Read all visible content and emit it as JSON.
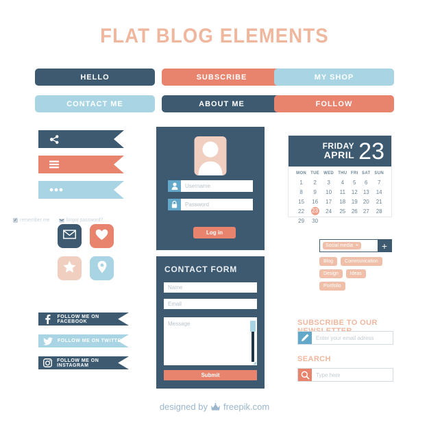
{
  "title": "FLAT BLOG ELEMENTS",
  "colors": {
    "dark": "#3d5a70",
    "salmon": "#e8836d",
    "light_blue": "#a8d4e3",
    "peach": "#f0cfc0",
    "title_peach": "#eeb79e",
    "tag_peach": "#f0bfa9",
    "white": "#ffffff"
  },
  "buttons": [
    {
      "label": "HELLO",
      "style": "b-dark"
    },
    {
      "label": "SUBSCRIBE",
      "style": "b-salmon"
    },
    {
      "label": "MY SHOP",
      "style": "b-lblue"
    },
    {
      "label": "CONTACT ME",
      "style": "b-lblue"
    },
    {
      "label": "ABOUT ME",
      "style": "b-dark"
    },
    {
      "label": "FOLLOW",
      "style": "b-salmon"
    }
  ],
  "ribbons": [
    {
      "icon": "share-icon",
      "style": "b-dark"
    },
    {
      "icon": "hamburger-icon",
      "style": "b-salmon"
    },
    {
      "icon": "ellipsis-icon",
      "style": "b-lblue"
    }
  ],
  "tiles": [
    {
      "icon": "envelope-icon",
      "bg": "#3d5a70",
      "fg": "#ffffff"
    },
    {
      "icon": "heart-icon",
      "bg": "#e8836d",
      "fg": "#ffffff"
    },
    {
      "icon": "star-icon",
      "bg": "#f0cfc0",
      "fg": "#ffffff"
    },
    {
      "icon": "location-pin-icon",
      "bg": "#a8d4e3",
      "fg": "#ffffff"
    }
  ],
  "social": [
    {
      "icon": "facebook-icon",
      "label": "FOLLOW ME ON FACEBOOK",
      "style": "b-dark"
    },
    {
      "icon": "twitter-icon",
      "label": "FOLLOW ME ON TWITTER",
      "style": "b-lblue"
    },
    {
      "icon": "instagram-icon",
      "label": "FOLLOW ME ON INSTAGRAM",
      "style": "b-dark"
    }
  ],
  "login": {
    "avatar_icon": "user-avatar-icon",
    "username": {
      "icon": "user-icon",
      "placeholder": "Username",
      "value": ""
    },
    "password": {
      "icon": "lock-icon",
      "placeholder": "Password",
      "value": ""
    },
    "remember_label": "remember me",
    "remember_checked": true,
    "forgot_label": "forgot password?",
    "forgot_icon": "envelope-icon",
    "submit_label": "Log in"
  },
  "contact_form": {
    "title": "CONTACT FORM",
    "name": {
      "placeholder": "Name",
      "value": ""
    },
    "email": {
      "placeholder": "Email",
      "value": ""
    },
    "message": {
      "placeholder": "Message",
      "value": ""
    },
    "submit_label": "Submit"
  },
  "calendar": {
    "weekday": "FRIDAY",
    "month": "APRIL",
    "day_number": "23",
    "day_headers": [
      "MON",
      "TUE",
      "WED",
      "THU",
      "FRI",
      "SAT",
      "SUN"
    ],
    "weeks": [
      [
        "1",
        "2",
        "3",
        "4",
        "5",
        "6",
        "7"
      ],
      [
        "8",
        "9",
        "10",
        "11",
        "12",
        "13",
        "14"
      ],
      [
        "15",
        "16",
        "17",
        "18",
        "19",
        "20",
        "21"
      ],
      [
        "22",
        "23",
        "24",
        "25",
        "26",
        "27",
        "28"
      ],
      [
        "29",
        "30",
        "",
        "",
        "",
        "",
        ""
      ]
    ],
    "selected": "23"
  },
  "tags": {
    "input_chip": "Social media",
    "chip_remove": "×",
    "add_label": "+",
    "rows": [
      [
        "Blog",
        "Communication"
      ],
      [
        "Design",
        "Ideas"
      ],
      [
        "Portfolio"
      ]
    ]
  },
  "newsletter": {
    "title": "SUBSCRIBE TO OUR NEWSLETTER",
    "icon": "pencil-icon",
    "placeholder": "Enter your email adress",
    "value": ""
  },
  "search": {
    "title": "SEARCH",
    "icon": "search-icon",
    "placeholder": "Type here",
    "value": ""
  },
  "footer": {
    "prefix": "designed by",
    "brand": "freepik.com",
    "logo_icon": "freepik-crown-icon"
  }
}
